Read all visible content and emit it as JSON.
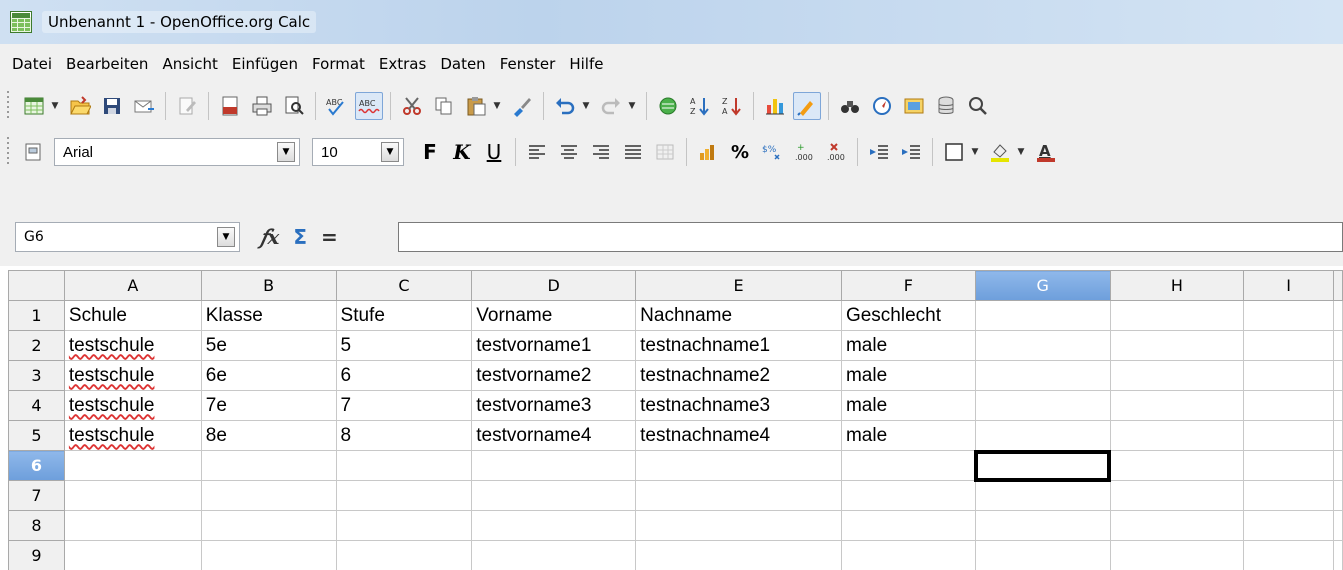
{
  "window": {
    "title": "Unbenannt 1 - OpenOffice.org Calc"
  },
  "menu": {
    "items": [
      {
        "label": "Datei"
      },
      {
        "label": "Bearbeiten"
      },
      {
        "label": "Ansicht"
      },
      {
        "label": "Einfügen"
      },
      {
        "label": "Format"
      },
      {
        "label": "Extras"
      },
      {
        "label": "Daten"
      },
      {
        "label": "Fenster"
      },
      {
        "label": "Hilfe"
      }
    ]
  },
  "format_toolbar": {
    "font_name": "Arial",
    "font_size": "10",
    "bold": "F",
    "italic": "K",
    "underline": "U"
  },
  "formula_bar": {
    "name_box": "G6",
    "formula": ""
  },
  "sheet": {
    "columns": [
      "A",
      "B",
      "C",
      "D",
      "E",
      "F",
      "G",
      "H",
      "I"
    ],
    "selected_column": "G",
    "selected_row": "6",
    "rows": [
      {
        "num": "1",
        "cells": [
          "Schule",
          "Klasse",
          "Stufe",
          "Vorname",
          "Nachname",
          "Geschlecht",
          "",
          "",
          ""
        ]
      },
      {
        "num": "2",
        "cells": [
          "testschule",
          "5e",
          "5",
          "testvorname1",
          "testnachname1",
          "male",
          "",
          "",
          ""
        ]
      },
      {
        "num": "3",
        "cells": [
          "testschule",
          "6e",
          "6",
          "testvorname2",
          "testnachname2",
          "male",
          "",
          "",
          ""
        ]
      },
      {
        "num": "4",
        "cells": [
          "testschule",
          "7e",
          "7",
          "testvorname3",
          "testnachname3",
          "male",
          "",
          "",
          ""
        ]
      },
      {
        "num": "5",
        "cells": [
          "testschule",
          "8e",
          "8",
          "testvorname4",
          "testnachname4",
          "male",
          "",
          "",
          ""
        ]
      },
      {
        "num": "6",
        "cells": [
          "",
          "",
          "",
          "",
          "",
          "",
          "",
          "",
          ""
        ]
      },
      {
        "num": "7",
        "cells": [
          "",
          "",
          "",
          "",
          "",
          "",
          "",
          "",
          ""
        ]
      },
      {
        "num": "8",
        "cells": [
          "",
          "",
          "",
          "",
          "",
          "",
          "",
          "",
          ""
        ]
      },
      {
        "num": "9",
        "cells": [
          "",
          "",
          "",
          "",
          "",
          "",
          "",
          "",
          ""
        ]
      }
    ]
  },
  "colors": {
    "selection_header": "#7aa8e2",
    "spell_error": "#dd3333"
  }
}
